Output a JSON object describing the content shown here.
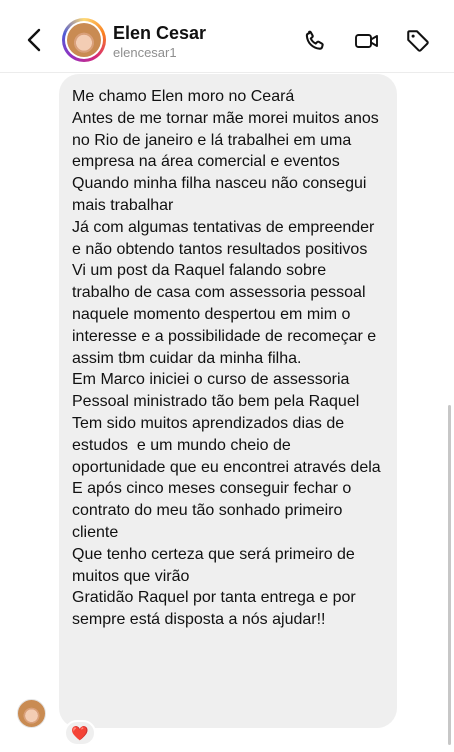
{
  "header": {
    "name": "Elen Cesar",
    "username": "elencesar1",
    "icons": [
      "back-icon",
      "phone-icon",
      "video-icon",
      "tag-icon"
    ]
  },
  "message": {
    "lines": [
      "Me chamo Elen moro no Ceará",
      "Antes de me tornar mãe morei muitos anos no Rio de janeiro e lá trabalhei em uma empresa na área comercial e eventos",
      "Quando minha filha nasceu não consegui mais trabalhar",
      "Já com algumas tentativas de empreender e não obtendo tantos resultados positivos",
      "Vi um post da Raquel falando sobre trabalho de casa com assessoria pessoal naquele momento despertou em mim o interesse e a possibilidade de recomeçar e assim tbm cuidar da minha filha.",
      "Em Marco iniciei o curso de assessoria Pessoal ministrado tão bem pela Raquel",
      "Tem sido muitos aprendizados dias de estudos  e um mundo cheio de oportunidade que eu encontrei através dela",
      "E após cinco meses conseguir fechar o contrato do meu tão sonhado primeiro cliente",
      "Que tenho certeza que será primeiro de muitos que virão",
      "Gratidão Raquel por tanta entrega e por sempre está disposta a nós ajudar!!"
    ],
    "reaction": "❤️"
  }
}
